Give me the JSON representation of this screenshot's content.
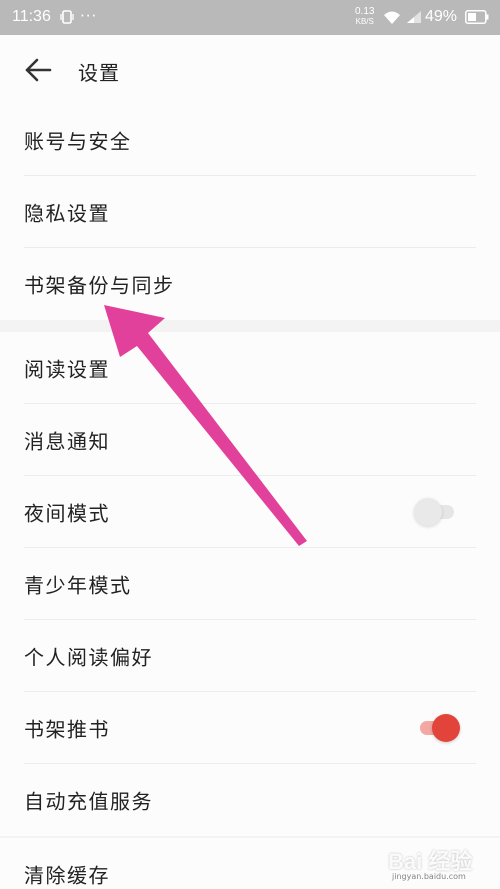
{
  "status_bar": {
    "time": "11:36",
    "dots": "···",
    "speed_value": "0.13",
    "speed_unit": "KB/S",
    "battery": "49%"
  },
  "header": {
    "title": "设置"
  },
  "groups": [
    {
      "items": [
        {
          "label": "账号与安全"
        },
        {
          "label": "隐私设置"
        },
        {
          "label": "书架备份与同步"
        }
      ]
    },
    {
      "items": [
        {
          "label": "阅读设置"
        },
        {
          "label": "消息通知"
        },
        {
          "label": "夜间模式",
          "toggle": "off"
        },
        {
          "label": "青少年模式"
        },
        {
          "label": "个人阅读偏好"
        },
        {
          "label": "书架推书",
          "toggle": "on"
        },
        {
          "label": "自动充值服务"
        }
      ]
    },
    {
      "items": [
        {
          "label": "清除缓存"
        }
      ]
    }
  ],
  "colors": {
    "accent_toggle": "#e2433b",
    "annotation_arrow": "#e2419b"
  },
  "watermark": {
    "text": "Bai 经验",
    "sub": "jingyan.baidu.com"
  }
}
